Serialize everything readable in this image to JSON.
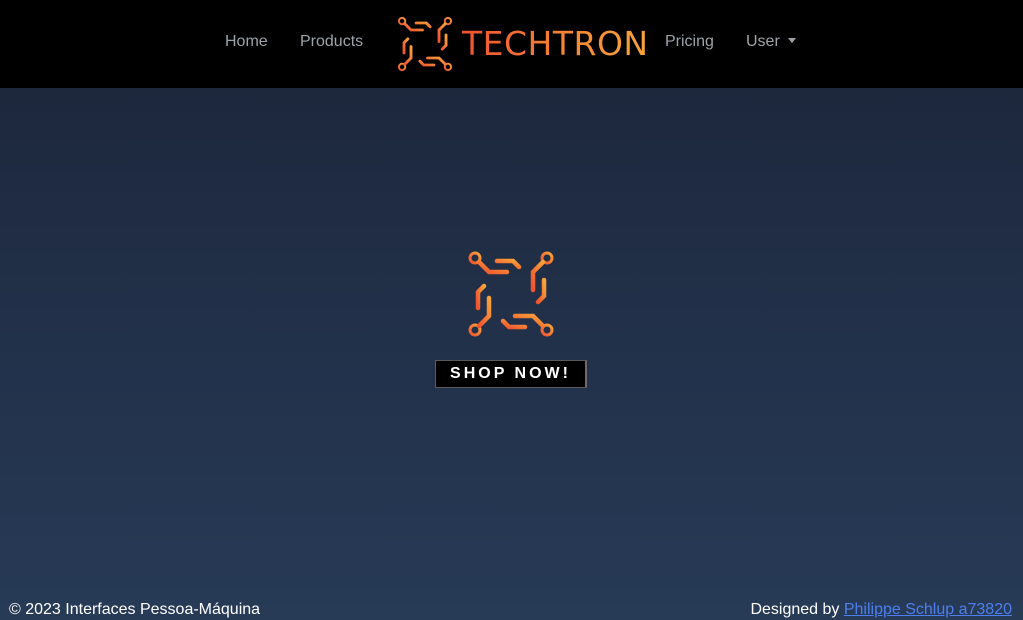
{
  "navbar": {
    "links": {
      "home": "Home",
      "products": "Products",
      "pricing": "Pricing",
      "user": "User"
    },
    "brand_name": "TECHTRON"
  },
  "hero": {
    "button_label": "SHOP NOW!"
  },
  "footer": {
    "copyright": "© 2023 Interfaces Pessoa-Máquina",
    "designed_by_label": "Designed by",
    "designer_link": "Philippe Schlup a73820"
  },
  "colors": {
    "navbar_bg": "#000000",
    "page_bg_top": "#1b2438",
    "page_bg_bottom": "#273a56",
    "brand_gradient_start": "#f0532f",
    "brand_gradient_end": "#f7a33a",
    "link_color": "#4d7ff0"
  },
  "icons": {
    "brand_logo": "techtron-logo-icon",
    "hero_logo": "techtron-logo-icon",
    "user_dropdown": "caret-down-icon"
  }
}
